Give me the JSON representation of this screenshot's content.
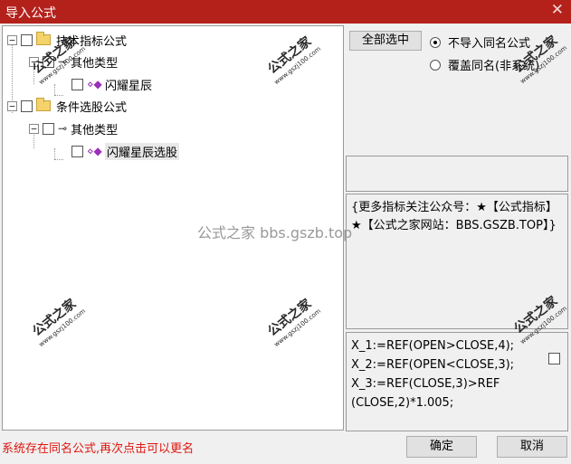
{
  "window": {
    "title": "导入公式",
    "close_glyph": "✕"
  },
  "tree": {
    "items": [
      {
        "label": "技术指标公式",
        "kind": "folder",
        "expander": "−"
      },
      {
        "label": "其他类型",
        "kind": "key",
        "expander": "−"
      },
      {
        "label": "闪耀星辰",
        "kind": "formula"
      },
      {
        "label": "条件选股公式",
        "kind": "folder",
        "expander": "−"
      },
      {
        "label": "其他类型",
        "kind": "key",
        "expander": "−"
      },
      {
        "label": "闪耀星辰选股",
        "kind": "formula",
        "selected": true
      }
    ]
  },
  "select_all_label": "全部选中",
  "radio_options": [
    {
      "label": "不导入同名公式",
      "checked": true
    },
    {
      "label": "覆盖同名(非系统)",
      "checked": false
    }
  ],
  "description": "{更多指标关注公众号：★【公式指标】★【公式之家网站：BBS.GSZB.TOP】}",
  "code_lines": [
    "X_1:=REF(OPEN>CLOSE,4);",
    "X_2:=REF(OPEN<CLOSE,3);",
    "X_3:=REF(CLOSE,3)>REF",
    "(CLOSE,2)*1.005;"
  ],
  "status_text": "系统存在同名公式,再次点击可以更名",
  "ok_label": "确定",
  "cancel_label": "取消",
  "watermark_text": "公式之家 bbs.gszb.top",
  "stamp": {
    "title": "公式之家",
    "url": "www.gszj100.com"
  }
}
